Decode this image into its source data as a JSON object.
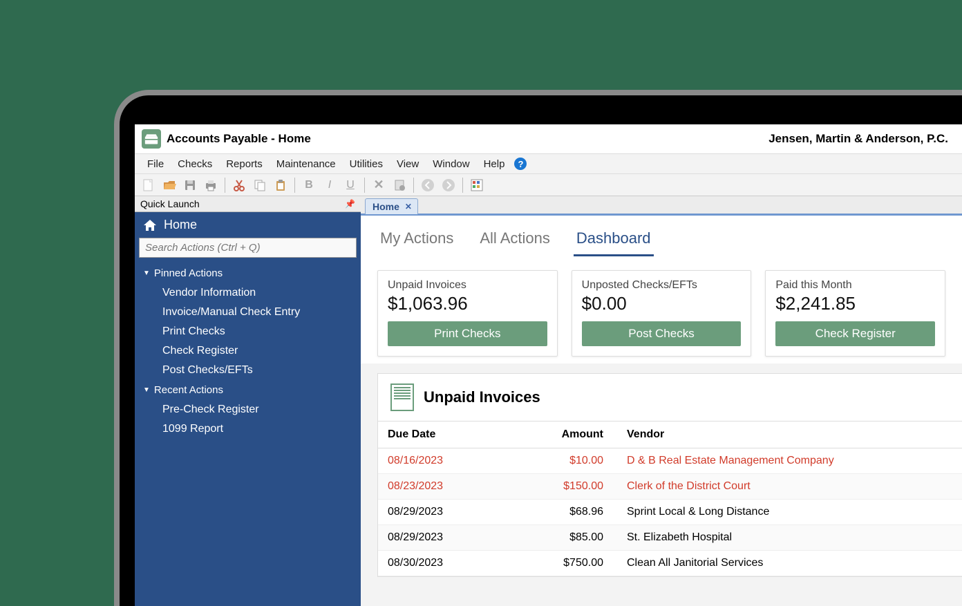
{
  "title": "Accounts Payable - Home",
  "company": "Jensen, Martin & Anderson, P.C.",
  "menu": [
    "File",
    "Checks",
    "Reports",
    "Maintenance",
    "Utilities",
    "View",
    "Window",
    "Help"
  ],
  "sidebar": {
    "panel_title": "Quick Launch",
    "home_label": "Home",
    "search_placeholder": "Search Actions (Ctrl + Q)",
    "pinned_header": "Pinned Actions",
    "pinned": [
      "Vendor Information",
      "Invoice/Manual Check Entry",
      "Print Checks",
      "Check Register",
      "Post Checks/EFTs"
    ],
    "recent_header": "Recent Actions",
    "recent": [
      "Pre-Check Register",
      "1099 Report"
    ]
  },
  "doc_tab": "Home",
  "sub_tabs": [
    "My Actions",
    "All Actions",
    "Dashboard"
  ],
  "active_sub_tab": 2,
  "cards": [
    {
      "label": "Unpaid Invoices",
      "value": "$1,063.96",
      "button": "Print Checks"
    },
    {
      "label": "Unposted Checks/EFTs",
      "value": "$0.00",
      "button": "Post Checks"
    },
    {
      "label": "Paid this Month",
      "value": "$2,241.85",
      "button": "Check Register"
    }
  ],
  "invoice_section_title": "Unpaid Invoices",
  "invoice_columns": [
    "Due Date",
    "Amount",
    "Vendor"
  ],
  "invoices": [
    {
      "due": "08/16/2023",
      "amount": "$10.00",
      "vendor": "D & B Real Estate Management Company",
      "overdue": true
    },
    {
      "due": "08/23/2023",
      "amount": "$150.00",
      "vendor": "Clerk of the District Court",
      "overdue": true
    },
    {
      "due": "08/29/2023",
      "amount": "$68.96",
      "vendor": "Sprint Local & Long Distance",
      "overdue": false
    },
    {
      "due": "08/29/2023",
      "amount": "$85.00",
      "vendor": "St. Elizabeth Hospital",
      "overdue": false
    },
    {
      "due": "08/30/2023",
      "amount": "$750.00",
      "vendor": "Clean All Janitorial Services",
      "overdue": false
    }
  ]
}
